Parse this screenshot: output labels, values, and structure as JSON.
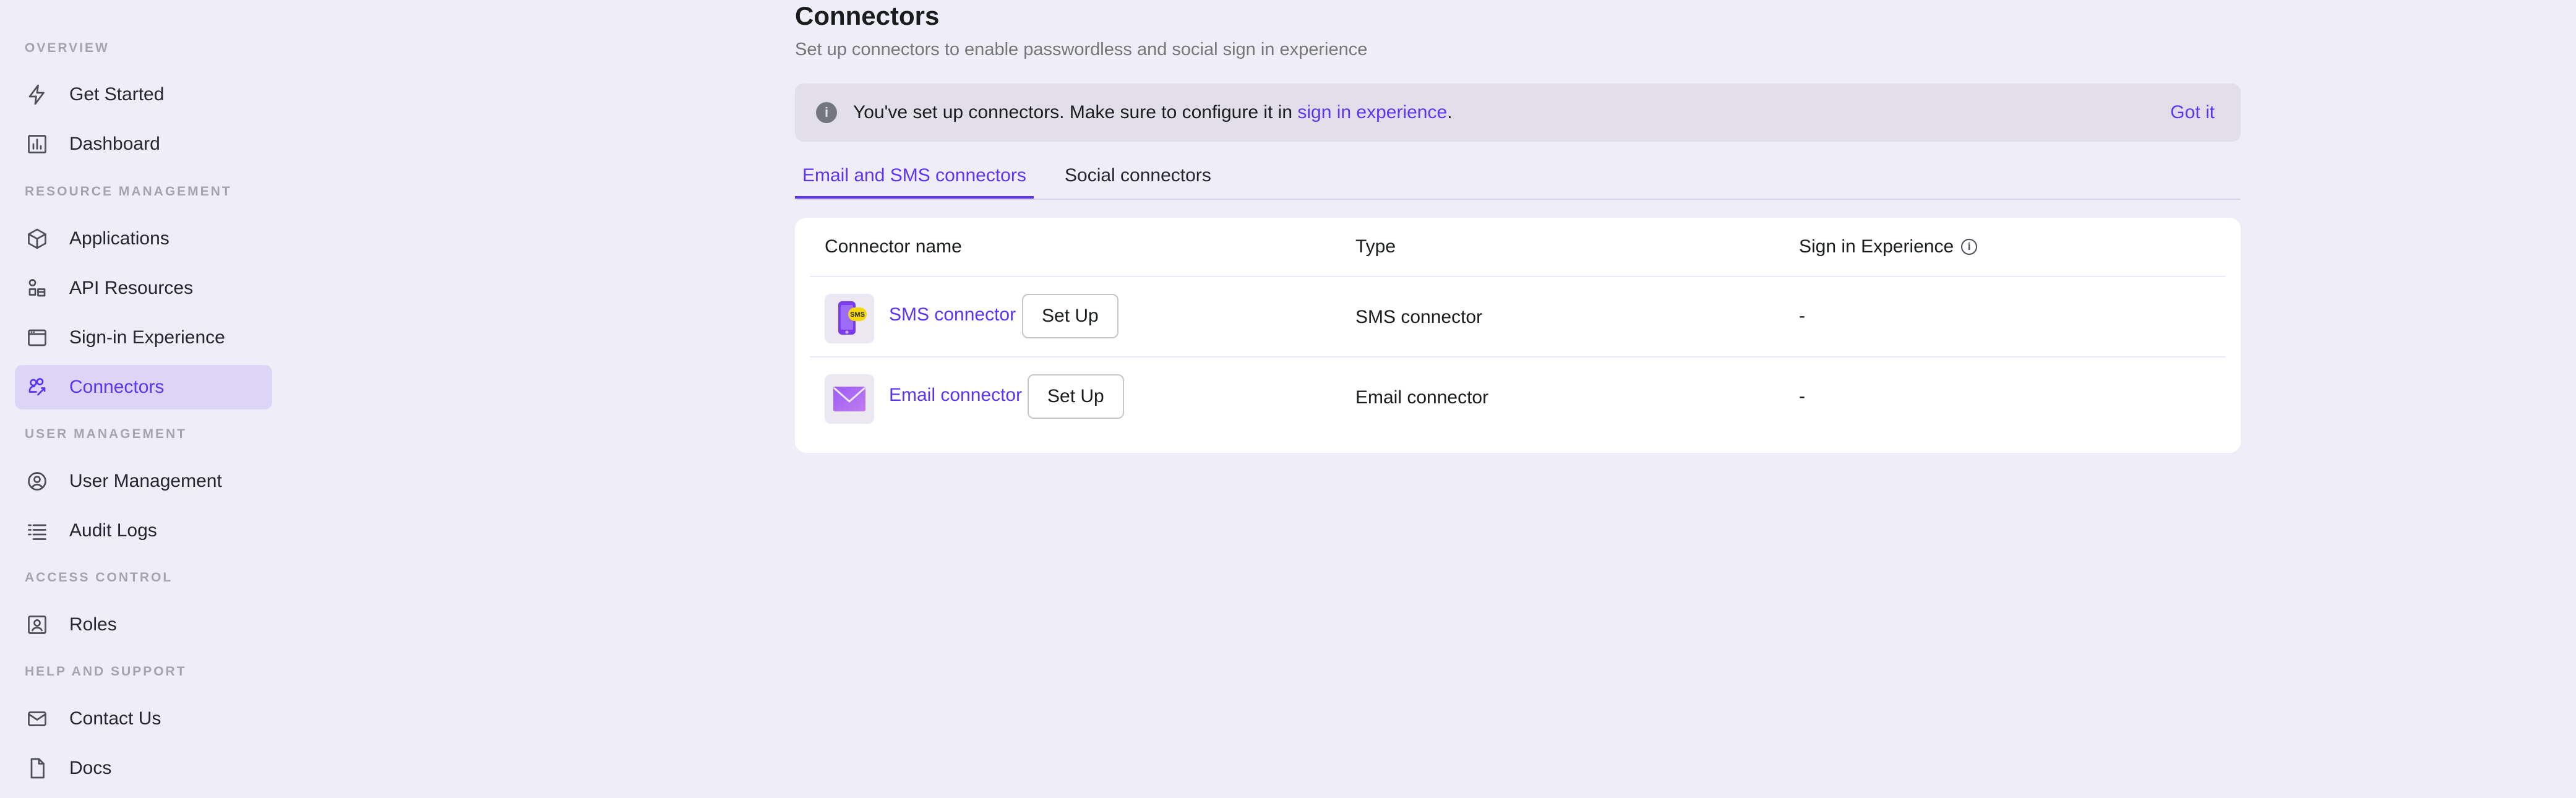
{
  "sidebar": {
    "sections": [
      {
        "title": "OVERVIEW",
        "items": [
          {
            "label": "Get Started",
            "icon": "lightning-icon"
          },
          {
            "label": "Dashboard",
            "icon": "chart-icon"
          }
        ]
      },
      {
        "title": "RESOURCE MANAGEMENT",
        "items": [
          {
            "label": "Applications",
            "icon": "cube-icon"
          },
          {
            "label": "API Resources",
            "icon": "api-resources-icon"
          },
          {
            "label": "Sign-in Experience",
            "icon": "browser-window-icon"
          },
          {
            "label": "Connectors",
            "icon": "connectors-icon",
            "active": true
          }
        ]
      },
      {
        "title": "USER MANAGEMENT",
        "items": [
          {
            "label": "User Management",
            "icon": "user-circle-icon"
          },
          {
            "label": "Audit Logs",
            "icon": "list-icon"
          }
        ]
      },
      {
        "title": "ACCESS CONTROL",
        "items": [
          {
            "label": "Roles",
            "icon": "role-badge-icon"
          }
        ]
      },
      {
        "title": "HELP AND SUPPORT",
        "items": [
          {
            "label": "Contact Us",
            "icon": "mail-icon"
          },
          {
            "label": "Docs",
            "icon": "document-icon"
          }
        ]
      }
    ]
  },
  "page": {
    "title": "Connectors",
    "subtitle": "Set up connectors to enable passwordless and social sign in experience"
  },
  "notice": {
    "text_before": "You've set up connectors. Make sure to configure it in ",
    "link_text": "sign in experience",
    "text_after": ".",
    "dismiss_label": "Got it"
  },
  "tabs": [
    {
      "label": "Email and SMS connectors",
      "active": true
    },
    {
      "label": "Social connectors",
      "active": false
    }
  ],
  "table": {
    "headers": {
      "name": "Connector name",
      "type": "Type",
      "sign_in_experience": "Sign in Experience"
    },
    "rows": [
      {
        "name": "SMS connector",
        "logo": "sms-logo-icon",
        "action_label": "Set Up",
        "type": "SMS connector",
        "sign_in_experience": "-"
      },
      {
        "name": "Email connector",
        "logo": "email-logo-icon",
        "action_label": "Set Up",
        "type": "Email connector",
        "sign_in_experience": "-"
      }
    ]
  },
  "colors": {
    "accent": "#5d34f2",
    "background": "#efedf7",
    "active_nav_background": "#dcd5f5",
    "notice_background": "#e2dfea"
  }
}
